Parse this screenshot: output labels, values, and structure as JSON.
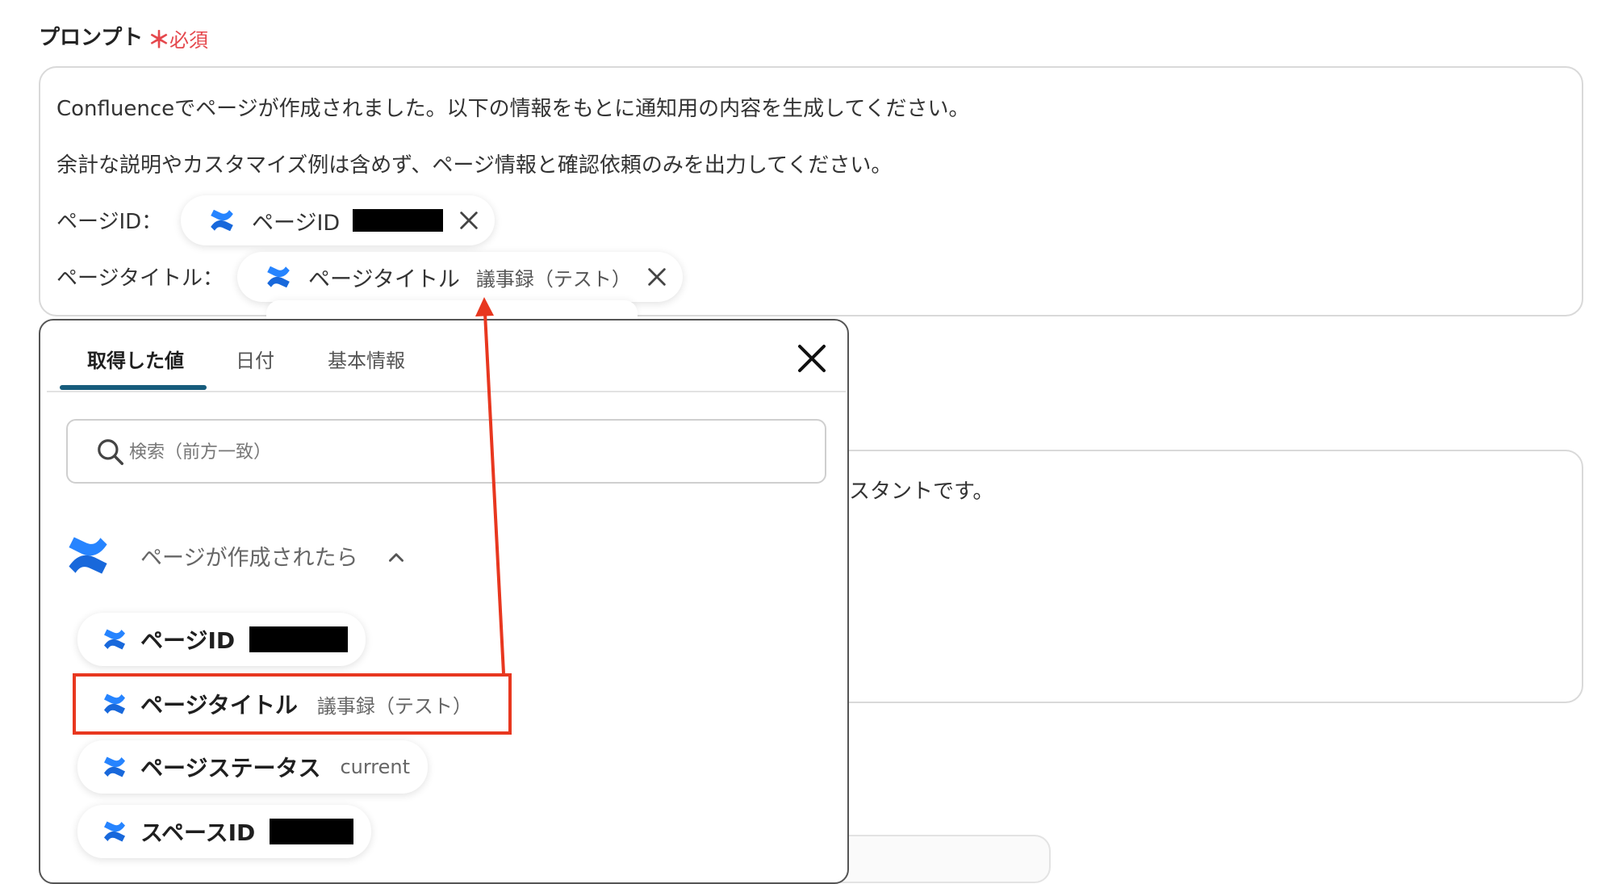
{
  "prompt": {
    "label": "プロンプト",
    "required_star": "＊",
    "required_text": "必須",
    "line1": "Confluenceでページが作成されました。以下の情報をもとに通知用の内容を生成してください。",
    "line2": "余計な説明やカスタマイズ例は含めず、ページ情報と確認依頼のみを出力してください。",
    "row1_label": "ページID：",
    "row1_chip": "ページID",
    "row2_label": "ページタイトル：",
    "row2_chip": "ページタイトル",
    "row2_chip_value": "議事録（テスト）"
  },
  "background_field": {
    "text": "スタントです。"
  },
  "popup": {
    "tabs": [
      {
        "label": "取得した値",
        "active": true
      },
      {
        "label": "日付",
        "active": false
      },
      {
        "label": "基本情報",
        "active": false
      }
    ],
    "search_placeholder": "検索（前方一致）",
    "section_title": "ページが作成されたら",
    "items": [
      {
        "label": "ページID",
        "value": ""
      },
      {
        "label": "ページタイトル",
        "value": "議事録（テスト）"
      },
      {
        "label": "ページステータス",
        "value": "current"
      },
      {
        "label": "スペースID",
        "value": ""
      }
    ]
  },
  "colors": {
    "confluence_blue": "#1868db",
    "required_red": "#e5484d",
    "highlight_red": "#e8371f",
    "tab_underline": "#175c7c"
  },
  "icons": [
    "confluence-icon",
    "close-icon",
    "search-icon",
    "chevron-up-icon",
    "remove-chip-icon"
  ]
}
